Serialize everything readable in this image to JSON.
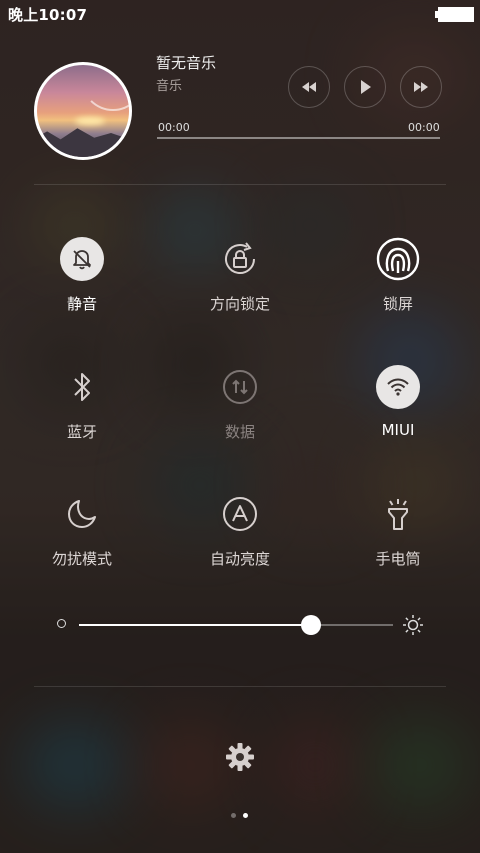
{
  "status_bar": {
    "time": "晚上10:07"
  },
  "media": {
    "title": "暂无音乐",
    "artist": "音乐",
    "elapsed": "00:00",
    "duration": "00:00",
    "progress": 0
  },
  "toggles": [
    {
      "label": "静音",
      "state": "on",
      "icon": "bell-muted-icon"
    },
    {
      "label": "方向锁定",
      "state": "off",
      "icon": "rotation-lock-icon"
    },
    {
      "label": "锁屏",
      "state": "off",
      "icon": "fingerprint-icon"
    },
    {
      "label": "蓝牙",
      "state": "off",
      "icon": "bluetooth-icon"
    },
    {
      "label": "数据",
      "state": "disabled",
      "icon": "mobile-data-icon"
    },
    {
      "label": "MIUI",
      "state": "on",
      "icon": "wifi-icon"
    },
    {
      "label": "勿扰模式",
      "state": "off",
      "icon": "moon-icon"
    },
    {
      "label": "自动亮度",
      "state": "off",
      "icon": "auto-brightness-icon"
    },
    {
      "label": "手电筒",
      "state": "off",
      "icon": "flashlight-icon"
    }
  ],
  "brightness": {
    "level": 0.74
  },
  "pager": {
    "pages": 2,
    "current": 2
  },
  "colors": {
    "toggle_on_bg": "#e8e6e5",
    "text_dim": "#8b8381"
  }
}
